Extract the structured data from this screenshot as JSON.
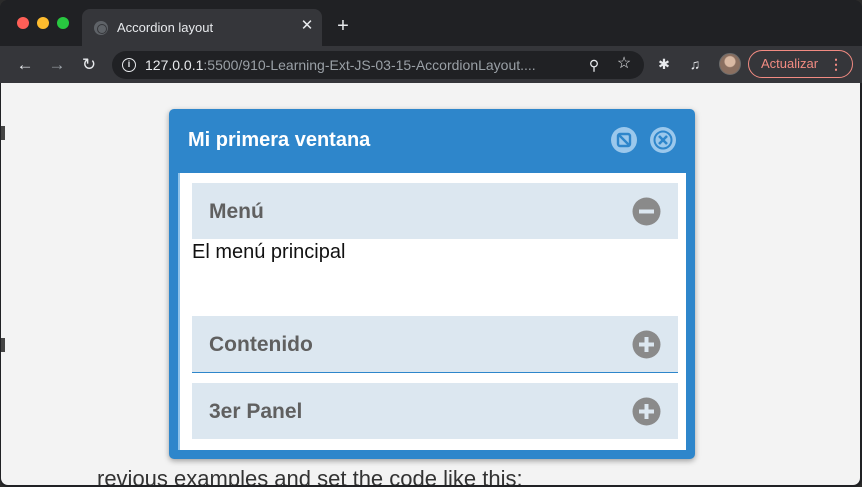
{
  "browser": {
    "tab_title": "Accordion layout",
    "tab_close": "✕",
    "new_tab": "+",
    "url_host": "127.0.0.1",
    "url_rest": ":5500/910-Learning-Ext-JS-03-15-AccordionLayout....",
    "update_label": "Actualizar",
    "menu_dots": "⋮",
    "icons": [
      "back-icon",
      "forward-icon",
      "reload-icon",
      "info-icon",
      "zoom-icon",
      "star-icon",
      "extensions-icon",
      "media-icon"
    ]
  },
  "window": {
    "title": "Mi primera ventana",
    "accent_color": "#2e86cb",
    "header_color": "#dce7f0"
  },
  "accordion": {
    "panels": [
      {
        "title": "Menú",
        "expanded": true,
        "content": "El menú principal"
      },
      {
        "title": "Contenido",
        "expanded": false
      },
      {
        "title": "3er Panel",
        "expanded": false
      }
    ]
  },
  "background": {
    "text": "revious examples and set the code like this:"
  }
}
